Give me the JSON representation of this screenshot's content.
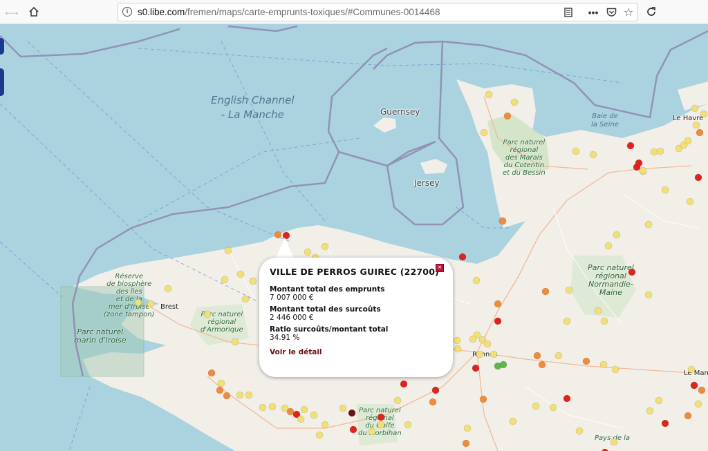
{
  "browser": {
    "url_host": "s0.libe.com",
    "url_path": "/fremen/maps/carte-emprunts-toxiques/#Communes-0014468"
  },
  "map": {
    "sea_labels": [
      "English Channel",
      "- La Manche"
    ],
    "bay_label": [
      "Baie de",
      "la Seine"
    ],
    "islands": {
      "guernsey": "Guernsey",
      "jersey": "Jersey"
    },
    "towns": {
      "brest": "Brest",
      "le_havre": "Le Havre",
      "le_mans": "Le Mans",
      "rennes": "Rennes"
    },
    "parks": {
      "iroise_reserve": [
        "Réserve",
        "de biosphère",
        "des îles",
        "et de la",
        "mer d'Iroise",
        "(zone tampon)"
      ],
      "iroise_marine": [
        "Parc naturel",
        "marin d'Iroise"
      ],
      "armorique": [
        "Parc naturel",
        "régional",
        "d'Armorique"
      ],
      "cotentin": [
        "Parc naturel",
        "régional",
        "des Marais",
        "du Cotentin",
        "et du Bessin"
      ],
      "normandie_maine": [
        "Parc naturel",
        "régional",
        "Normandie-",
        "Maine"
      ],
      "golfe_morbihan": [
        "Parc naturel",
        "régional",
        "du Golfe",
        "du Morbihan"
      ],
      "pays_de_la": "Pays de la"
    },
    "marker_colors": {
      "low": "#f2df75",
      "medium": "#ee8c3c",
      "high": "#e0231c",
      "very_high": "#6a1212",
      "minimal": "#5cb84a"
    }
  },
  "popup": {
    "title": "VILLE DE PERROS GUIREC (22700)",
    "rows": [
      {
        "label": "Montant total des emprunts",
        "value": "7 007 000 €"
      },
      {
        "label": "Montant total des surcoûts",
        "value": "2 446 000 €"
      },
      {
        "label": "Ratio surcoûts/montant total",
        "value": "34.91 %"
      }
    ],
    "link": "Voir le détail"
  }
}
